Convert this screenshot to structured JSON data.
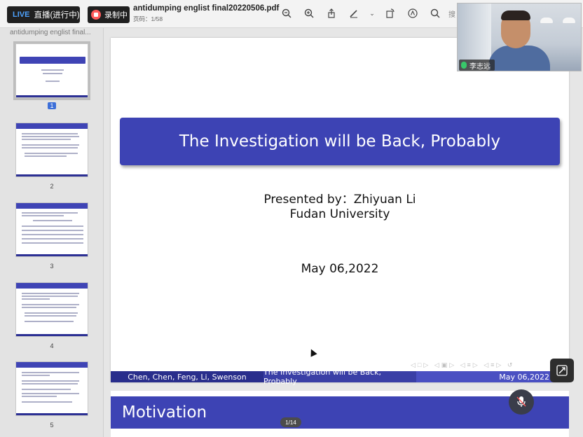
{
  "topbar": {
    "live_tag": "LIVE",
    "live_label": "直播(进行中)",
    "record_label": "录制中",
    "doc_title": "antidumping englist final20220506.pdf",
    "page_count": "页码：1/58",
    "search_placeholder": "搜"
  },
  "sidebar": {
    "file_name": "antidumping englist final...",
    "thumbnails": [
      {
        "number": "1",
        "selected": true
      },
      {
        "number": "2"
      },
      {
        "number": "3"
      },
      {
        "number": "4"
      },
      {
        "number": "5"
      }
    ]
  },
  "slide": {
    "title": "The Investigation will be Back, Probably",
    "presenter": "Presented by：Zhiyuan Li",
    "university": "Fudan University",
    "date": "May 06,2022",
    "footer_authors": "Chen, Chen, Feng, Li, Swenson",
    "footer_title": "The Investigation will be Back, Probably",
    "footer_date": "May 06,2022"
  },
  "next_slide": {
    "title": "Motivation"
  },
  "pager": "1/14",
  "webcam": {
    "participant_name": "李志远"
  },
  "colors": {
    "beamer_blue": "#3d43b4",
    "footer_dark": "#292e8c"
  }
}
